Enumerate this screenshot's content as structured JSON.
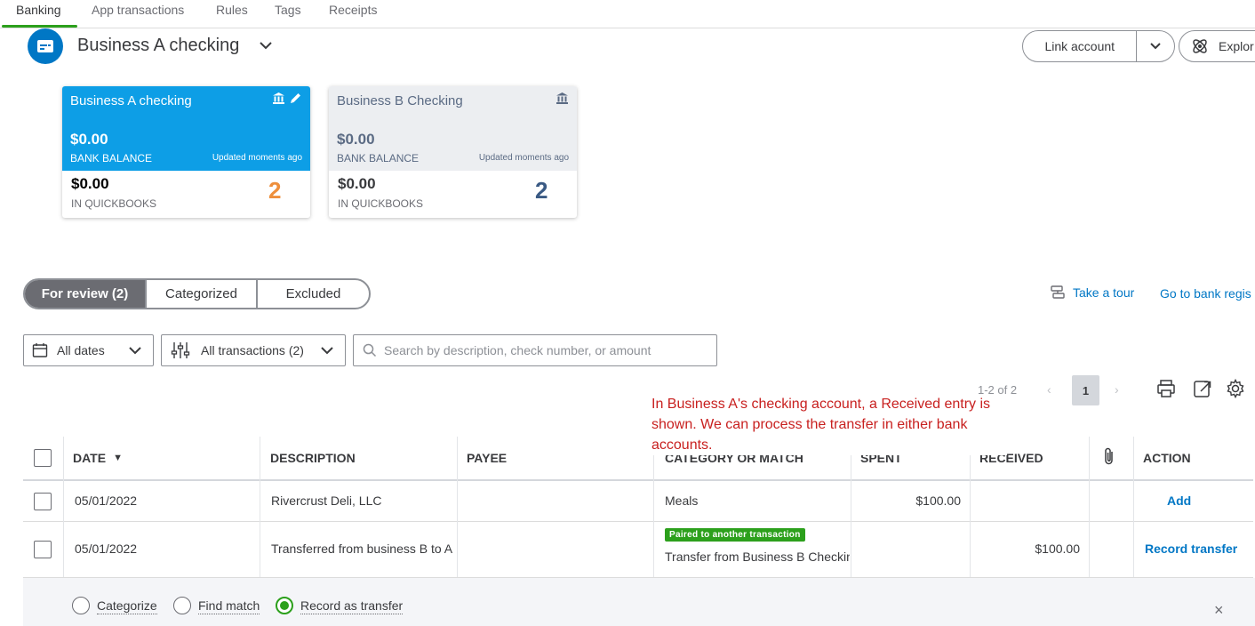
{
  "top_tabs": [
    {
      "label": "Banking",
      "active": true
    },
    {
      "label": "App transactions",
      "active": false
    },
    {
      "label": "Rules",
      "active": false
    },
    {
      "label": "Tags",
      "active": false
    },
    {
      "label": "Receipts",
      "active": false
    }
  ],
  "account": {
    "title": "Business A checking",
    "link_account_label": "Link account",
    "explore_label": "Explor"
  },
  "cards": [
    {
      "name": "Business A checking",
      "bank_balance": "$0.00",
      "bank_balance_label": "BANK BALANCE",
      "updated": "Updated moments ago",
      "qb_balance": "$0.00",
      "qb_label": "IN QUICKBOOKS",
      "count": "2",
      "selected": true
    },
    {
      "name": "Business B Checking",
      "bank_balance": "$0.00",
      "bank_balance_label": "BANK BALANCE",
      "updated": "Updated moments ago",
      "qb_balance": "$0.00",
      "qb_label": "IN QUICKBOOKS",
      "count": "2",
      "selected": false
    }
  ],
  "review_tabs": [
    "For review (2)",
    "Categorized",
    "Excluded"
  ],
  "links": {
    "take_tour": "Take a tour",
    "go_to_register": "Go to bank regis"
  },
  "filters": {
    "dates": "All dates",
    "transactions": "All transactions (2)",
    "search_placeholder": "Search by description, check number, or amount"
  },
  "pager": {
    "range": "1-2 of 2",
    "current_page": "1",
    "prev": "‹",
    "next": "›"
  },
  "annotation": "In Business A's checking account, a Received entry is shown. We can process the transfer in either bank accounts.",
  "table": {
    "headers": {
      "date": "DATE",
      "sort_indicator": "▼",
      "description": "DESCRIPTION",
      "payee": "PAYEE",
      "category": "CATEGORY OR MATCH",
      "spent": "SPENT",
      "received": "RECEIVED",
      "action": "ACTION"
    },
    "rows": [
      {
        "date": "05/01/2022",
        "description": "Rivercrust Deli, LLC",
        "payee": "",
        "category": "Meals",
        "badge": "",
        "spent": "$100.00",
        "received": "",
        "action": "Add"
      },
      {
        "date": "05/01/2022",
        "description": "Transferred from business B to A",
        "payee": "",
        "category": "Transfer from Business B Checkin",
        "badge": "Paired to another transaction",
        "spent": "",
        "received": "$100.00",
        "action": "Record transfer"
      }
    ]
  },
  "panel": {
    "options": [
      {
        "label": "Categorize",
        "selected": false
      },
      {
        "label": "Find match",
        "selected": false
      },
      {
        "label": "Record as transfer",
        "selected": true
      }
    ],
    "close": "×"
  },
  "colors": {
    "accent_green": "#2ca01c",
    "link_blue": "#0077c5",
    "card_selected_blue": "#0d9ee6",
    "count_orange": "#ee8f3c",
    "annotation_red": "#c8201f"
  }
}
